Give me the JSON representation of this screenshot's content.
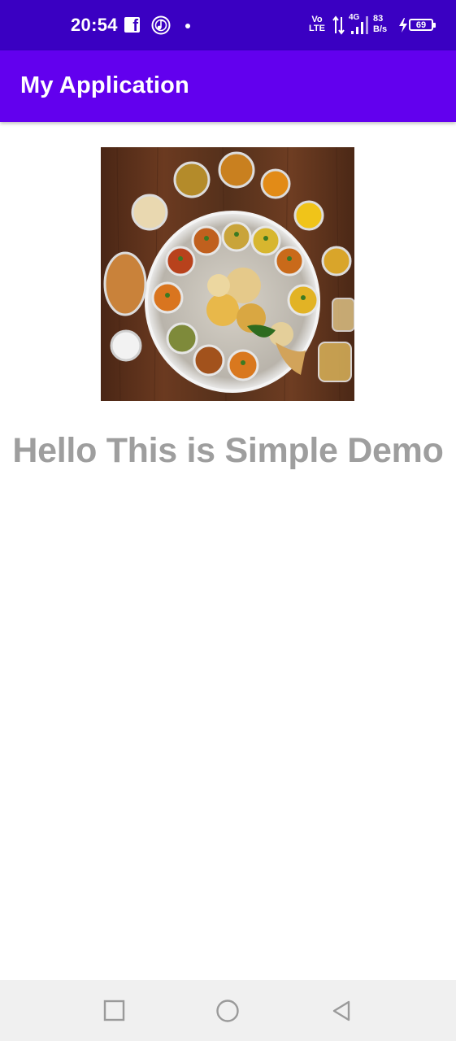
{
  "status_bar": {
    "time": "20:54",
    "volte_top": "Vo",
    "volte_bottom": "LTE",
    "network_type": "4G",
    "speed_value": "83",
    "speed_unit": "B/s",
    "battery_level": "69",
    "icons": [
      "facebook-icon",
      "music-icon",
      "notification-dot",
      "volte-icon",
      "data-arrows-icon",
      "signal-icon",
      "charging-icon",
      "battery-icon"
    ]
  },
  "app_bar": {
    "title": "My Application"
  },
  "main": {
    "hello_text": "Hello This is Simple Demo"
  },
  "nav_bar": {
    "icons": [
      "recents-icon",
      "home-icon",
      "back-icon"
    ]
  },
  "colors": {
    "status_bar": "#3a00c2",
    "app_bar": "#6200ee",
    "text_gray": "#9e9e9e",
    "nav_bar": "#f0f0f0"
  }
}
